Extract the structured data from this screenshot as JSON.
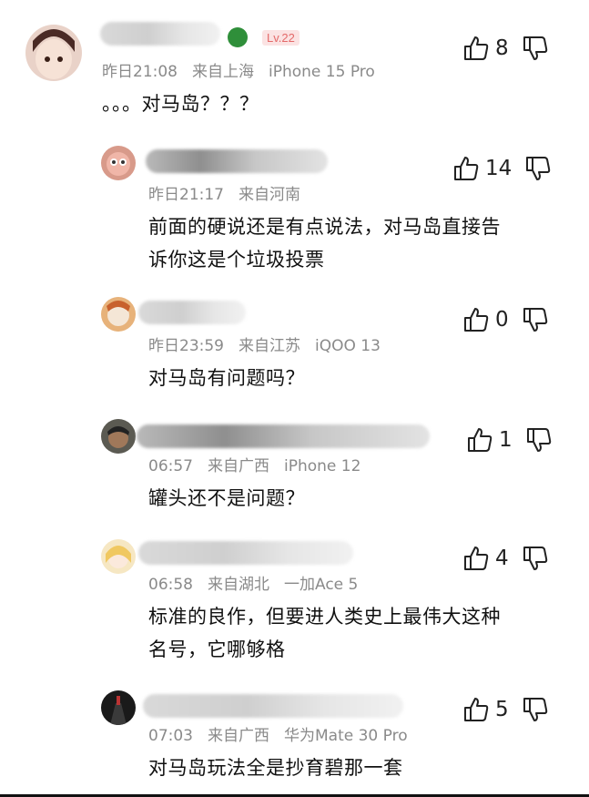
{
  "comments": [
    {
      "level": "Lv.22",
      "time": "昨日21:08",
      "location": "来自上海",
      "device": "iPhone 15 Pro",
      "likes": "8",
      "text": [
        "。。。对马岛？？？"
      ]
    },
    {
      "time": "昨日21:17",
      "location": "来自河南",
      "device": "",
      "likes": "14",
      "text": [
        "前面的硬说还是有点说法，对马岛直接告",
        "诉你这是个垃圾投票"
      ]
    },
    {
      "time": "昨日23:59",
      "location": "来自江苏",
      "device": "iQOO 13",
      "likes": "0",
      "text": [
        "对马岛有问题吗？"
      ]
    },
    {
      "time": "06:57",
      "location": "来自广西",
      "device": "iPhone 12",
      "likes": "1",
      "text": [
        "罐头还不是问题？"
      ]
    },
    {
      "time": "06:58",
      "location": "来自湖北",
      "device": "一加Ace 5",
      "likes": "4",
      "text": [
        "标准的良作，但要进人类史上最伟大这种",
        "名号，它哪够格"
      ]
    },
    {
      "time": "07:03",
      "location": "来自广西",
      "device": "华为Mate 30 Pro",
      "likes": "5",
      "text": [
        "对马岛玩法全是抄育碧那一套"
      ]
    }
  ],
  "icons": {
    "like": "thumbs-up-icon",
    "dislike": "thumbs-down-icon",
    "badge": "xbox-icon"
  }
}
